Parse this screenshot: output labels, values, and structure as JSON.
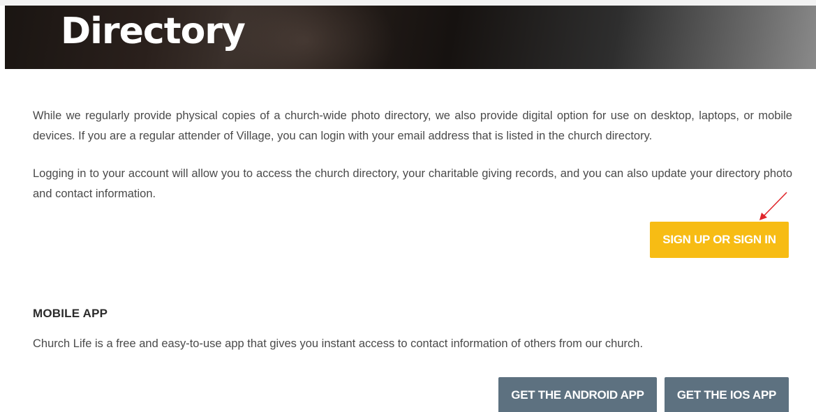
{
  "hero": {
    "title": "Directory"
  },
  "content": {
    "paragraph_1": "While we regularly provide physical copies of a church-wide photo directory, we also provide digital option for use on desktop, laptops, or mobile devices. If you are a regular attender of Village, you can login with your email address that is listed in the church directory.",
    "paragraph_2": "Logging in to your account will allow you to access the church directory, your charitable giving records, and you can also update your directory photo and contact information.",
    "signin_button": "SIGN UP OR SIGN IN"
  },
  "mobile_app": {
    "heading": "MOBILE APP",
    "description": "Church Life is a free and easy-to-use app that gives you instant access to contact information of others from our church.",
    "android_button": "GET THE ANDROID APP",
    "ios_button": "GET THE IOS APP"
  },
  "colors": {
    "signin_button": "#f7bc14",
    "app_buttons": "#5d7180",
    "annotation_arrow": "#e0262b"
  },
  "icons": {
    "annotation": "red-arrow-icon"
  }
}
